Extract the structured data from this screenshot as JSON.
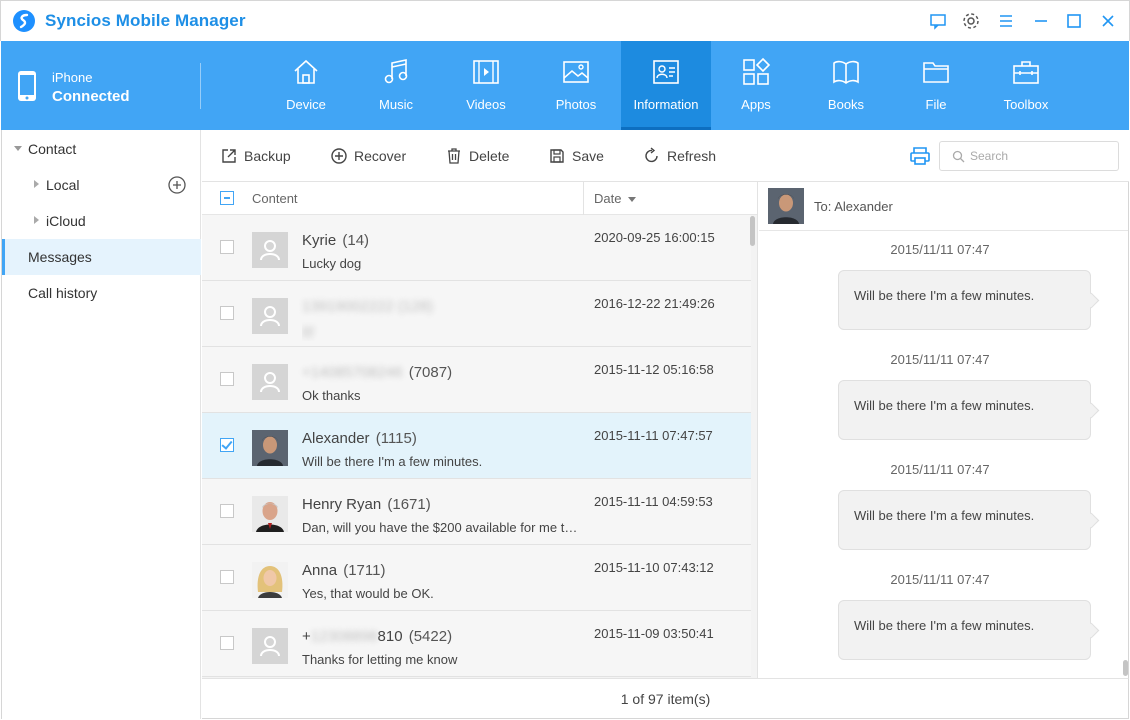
{
  "app": {
    "title": "Syncios Mobile Manager"
  },
  "device": {
    "name": "iPhone",
    "status": "Connected"
  },
  "nav": [
    {
      "label": "Device",
      "icon": "home-icon"
    },
    {
      "label": "Music",
      "icon": "music-icon"
    },
    {
      "label": "Videos",
      "icon": "video-icon"
    },
    {
      "label": "Photos",
      "icon": "photo-icon"
    },
    {
      "label": "Information",
      "icon": "contact-card-icon",
      "active": true
    },
    {
      "label": "Apps",
      "icon": "apps-icon"
    },
    {
      "label": "Books",
      "icon": "book-icon"
    },
    {
      "label": "File",
      "icon": "folder-icon"
    },
    {
      "label": "Toolbox",
      "icon": "toolbox-icon"
    }
  ],
  "sidebar": {
    "contact": "Contact",
    "local": "Local",
    "icloud": "iCloud",
    "messages": "Messages",
    "call_history": "Call history"
  },
  "toolbar": {
    "backup": "Backup",
    "recover": "Recover",
    "delete": "Delete",
    "save": "Save",
    "refresh": "Refresh",
    "search_placeholder": "Search"
  },
  "list": {
    "header_content": "Content",
    "header_date": "Date",
    "rows": [
      {
        "name": "Kyrie",
        "count": "(14)",
        "preview": "Lucky dog",
        "date": "2020-09-25 16:00:15",
        "avatar": "placeholder",
        "checked": false
      },
      {
        "name": "13919002222",
        "count": "(128)",
        "preview": "好",
        "date": "2016-12-22 21:49:26",
        "avatar": "placeholder",
        "checked": false,
        "blurred": true
      },
      {
        "name": "+14085708246",
        "count": "(7087)",
        "preview": "Ok thanks",
        "date": "2015-11-12 05:16:58",
        "avatar": "placeholder",
        "checked": false,
        "blurred_name": true
      },
      {
        "name": "Alexander",
        "count": "(1115)",
        "preview": "Will be there I'm a few minutes.",
        "date": "2015-11-11 07:47:57",
        "avatar": "photo-alexander",
        "checked": true
      },
      {
        "name": "Henry Ryan",
        "count": "(1671)",
        "preview": "Dan, will you have the $200 available for me tomorrow?",
        "date": "2015-11-11 04:59:53",
        "avatar": "photo-henry",
        "checked": false
      },
      {
        "name": "Anna",
        "count": "(1711)",
        "preview": "Yes, that would be OK.",
        "date": "2015-11-10 07:43:12",
        "avatar": "photo-anna",
        "checked": false
      },
      {
        "name_prefix": "+",
        "name_hidden": "12308898",
        "name_suffix": "810",
        "count": "(5422)",
        "preview": "Thanks for letting me know",
        "date": "2015-11-09 03:50:41",
        "avatar": "placeholder",
        "checked": false
      }
    ]
  },
  "footer": {
    "status": "1 of 97 item(s)"
  },
  "conversation": {
    "to": "To: Alexander",
    "messages": [
      {
        "time": "2015/11/11 07:47",
        "text": "Will be there I'm a few minutes."
      },
      {
        "time": "2015/11/11 07:47",
        "text": "Will be there I'm a few minutes."
      },
      {
        "time": "2015/11/11 07:47",
        "text": "Will be there I'm a few minutes."
      },
      {
        "time": "2015/11/11 07:47",
        "text": "Will be there I'm a few minutes."
      }
    ]
  },
  "colors": {
    "brand": "#41a5f5",
    "active_nav": "#1d8be0",
    "title": "#1e8fe6",
    "selected_row": "#e3f3fb"
  }
}
